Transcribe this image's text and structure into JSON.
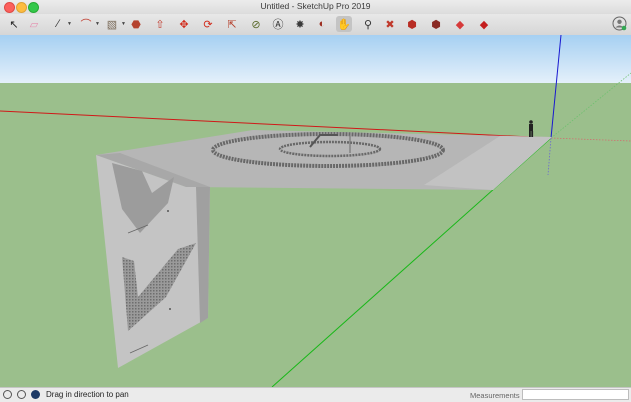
{
  "window": {
    "title": "Untitled - SketchUp Pro 2019"
  },
  "toolbar": {
    "tools": [
      {
        "name": "select-tool-icon",
        "glyph": "↖",
        "color": "#222222"
      },
      {
        "name": "eraser-tool-icon",
        "glyph": "▱",
        "color": "#e58fb0"
      },
      {
        "name": "line-tool-icon",
        "glyph": "∕",
        "color": "#333333"
      },
      {
        "name": "arc-tool-icon",
        "glyph": "⌒",
        "color": "#c0392b"
      },
      {
        "name": "shape-tool-icon",
        "glyph": "▧",
        "color": "#7a6a58"
      },
      {
        "name": "paint-bucket-icon",
        "glyph": "⬣",
        "color": "#b5432f"
      },
      {
        "name": "push-pull-icon",
        "glyph": "⇧",
        "color": "#c0392b"
      },
      {
        "name": "move-tool-icon",
        "glyph": "✥",
        "color": "#d12a1a"
      },
      {
        "name": "rotate-tool-icon",
        "glyph": "⟳",
        "color": "#d12a1a"
      },
      {
        "name": "scale-tool-icon",
        "glyph": "⇱",
        "color": "#b5432f"
      },
      {
        "name": "tape-measure-icon",
        "glyph": "⊘",
        "color": "#5a6a2a"
      },
      {
        "name": "text-tool-icon",
        "glyph": "Ⓐ",
        "color": "#333333"
      },
      {
        "name": "paint-tool-icon",
        "glyph": "✸",
        "color": "#3a3a3a"
      },
      {
        "name": "orbit-tool-icon",
        "glyph": "◐",
        "color": "#9b2b1e"
      },
      {
        "name": "pan-tool-icon",
        "glyph": "✋",
        "color": "#c08a3a"
      },
      {
        "name": "zoom-tool-icon",
        "glyph": "⚲",
        "color": "#333333"
      },
      {
        "name": "zoom-extents-icon",
        "glyph": "✖",
        "color": "#c0392b"
      },
      {
        "name": "warehouse-icon",
        "glyph": "⬢",
        "color": "#b82d24"
      },
      {
        "name": "extension-warehouse-icon",
        "glyph": "⬢",
        "color": "#8a2a24"
      },
      {
        "name": "send-to-layout-icon",
        "glyph": "◆",
        "color": "#d63a3a"
      },
      {
        "name": "extension-manager-icon",
        "glyph": "◆",
        "color": "#c41e1e"
      }
    ],
    "account_icon": "user-account-icon"
  },
  "status": {
    "message": "Drag in direction to pan",
    "measurements_label": "Measurements",
    "measurements_value": ""
  },
  "colors": {
    "sky_top": "#a6d0f2",
    "sky_bottom": "#e4f0fa",
    "ground": "#9bbf8c",
    "red_axis": "#d01818",
    "green_axis": "#18b818",
    "blue_axis": "#1818d0"
  }
}
